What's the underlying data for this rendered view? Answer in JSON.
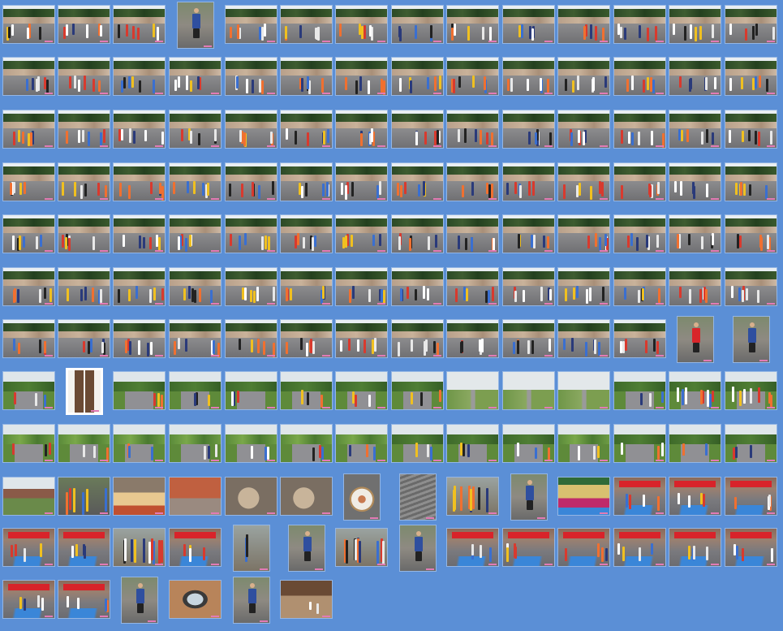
{
  "gallery": {
    "background": "#5b8fd6",
    "rows": [
      {
        "count": 14,
        "kinds": [
          "street",
          "street",
          "street",
          "portrait",
          "street",
          "street",
          "street",
          "street",
          "street",
          "street",
          "street",
          "street",
          "street",
          "street"
        ]
      },
      {
        "count": 14,
        "kinds": [
          "street",
          "street",
          "street",
          "street",
          "street",
          "street",
          "street",
          "street",
          "street",
          "street",
          "street",
          "street",
          "street",
          "street"
        ]
      },
      {
        "count": 14,
        "kinds": [
          "street",
          "street",
          "street",
          "street",
          "street",
          "street",
          "street",
          "street",
          "street",
          "street",
          "street",
          "street",
          "street",
          "street"
        ]
      },
      {
        "count": 14,
        "kinds": [
          "street",
          "street",
          "street",
          "street",
          "street",
          "street",
          "street",
          "street",
          "street",
          "street",
          "street",
          "street",
          "street",
          "street"
        ]
      },
      {
        "count": 14,
        "kinds": [
          "street",
          "street",
          "street",
          "street",
          "street",
          "street",
          "street",
          "street",
          "street",
          "street",
          "street",
          "street",
          "street",
          "street"
        ]
      },
      {
        "count": 14,
        "kinds": [
          "street",
          "street",
          "street",
          "street",
          "street",
          "street",
          "street",
          "street",
          "street",
          "street",
          "street",
          "street",
          "street",
          "street"
        ]
      },
      {
        "count": 14,
        "kinds": [
          "street",
          "street",
          "street",
          "street",
          "street",
          "street",
          "street",
          "street",
          "street",
          "street",
          "street",
          "street",
          "portrait-red",
          "portrait"
        ]
      },
      {
        "count": 14,
        "kinds": [
          "road",
          "door",
          "rural",
          "rural",
          "rural",
          "rural",
          "rural",
          "rural",
          "field",
          "field",
          "field",
          "rural",
          "group",
          "group"
        ]
      },
      {
        "count": 14,
        "kinds": [
          "orchard",
          "orchard",
          "orchard",
          "orchard",
          "orchard",
          "orchard",
          "orchard",
          "rural",
          "rural",
          "rural",
          "orchard",
          "rural",
          "rural",
          "rural"
        ]
      },
      {
        "count": 14,
        "kinds": [
          "house",
          "group-red",
          "food",
          "courtyard",
          "dog",
          "dog",
          "medal",
          "stairs",
          "crowd",
          "portrait",
          "trophies",
          "finish",
          "finish",
          "finish"
        ]
      },
      {
        "count": 14,
        "kinds": [
          "finish",
          "finish",
          "crowd",
          "finish",
          "crowd-portrait",
          "portrait",
          "crowd",
          "portrait",
          "finish",
          "finish",
          "finish",
          "finish",
          "finish",
          "finish"
        ]
      },
      {
        "count": 6,
        "kinds": [
          "finish",
          "finish",
          "portrait",
          "watch",
          "portrait",
          "shoes"
        ]
      }
    ]
  }
}
